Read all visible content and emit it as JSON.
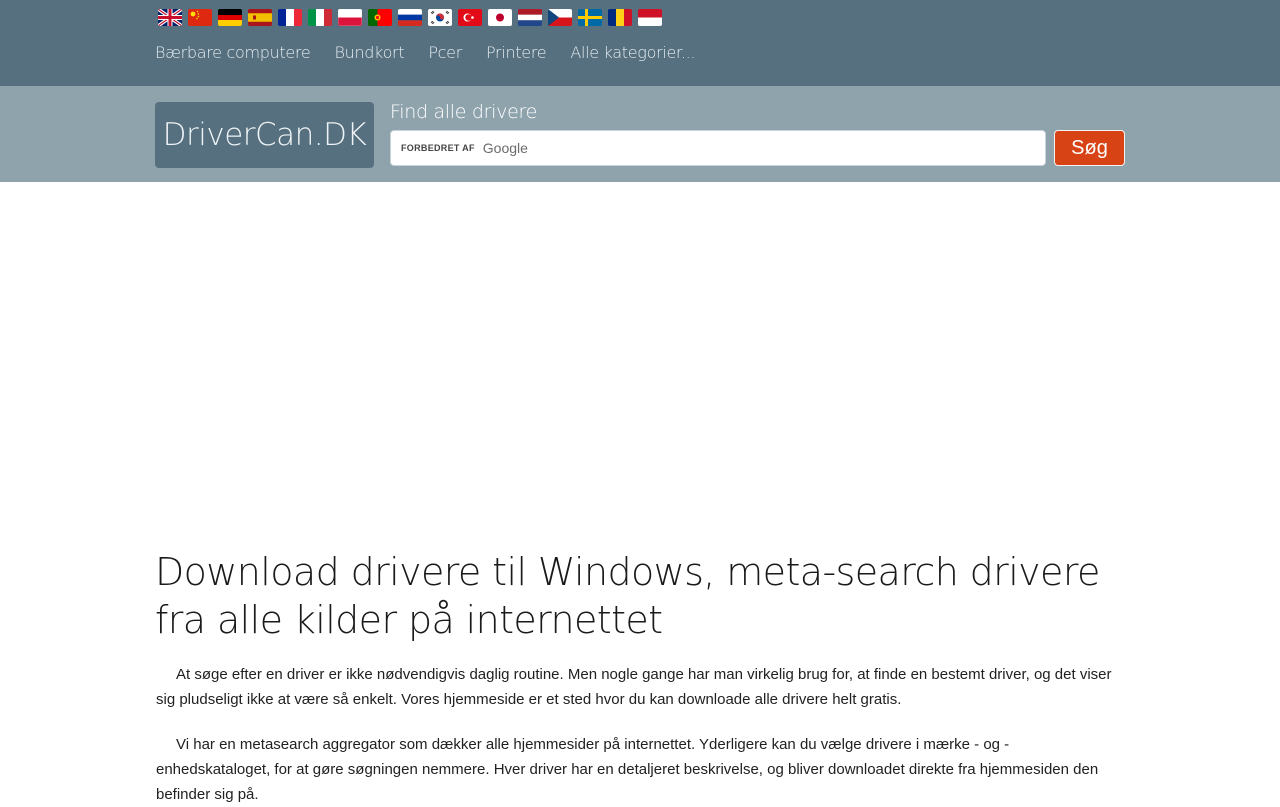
{
  "flags": [
    {
      "lang": "English",
      "icon": "flag-uk-icon"
    },
    {
      "lang": "Chinese",
      "icon": "flag-cn-icon"
    },
    {
      "lang": "German",
      "icon": "flag-de-icon"
    },
    {
      "lang": "Spanish",
      "icon": "flag-es-icon"
    },
    {
      "lang": "French",
      "icon": "flag-fr-icon"
    },
    {
      "lang": "Italian",
      "icon": "flag-it-icon"
    },
    {
      "lang": "Polish",
      "icon": "flag-pl-icon"
    },
    {
      "lang": "Portuguese",
      "icon": "flag-pt-icon"
    },
    {
      "lang": "Russian",
      "icon": "flag-ru-icon"
    },
    {
      "lang": "Korean",
      "icon": "flag-kr-icon"
    },
    {
      "lang": "Turkish",
      "icon": "flag-tr-icon"
    },
    {
      "lang": "Japanese",
      "icon": "flag-jp-icon"
    },
    {
      "lang": "Dutch",
      "icon": "flag-nl-icon"
    },
    {
      "lang": "Czech",
      "icon": "flag-cz-icon"
    },
    {
      "lang": "Swedish",
      "icon": "flag-se-icon"
    },
    {
      "lang": "Romanian",
      "icon": "flag-ro-icon"
    },
    {
      "lang": "Indonesian",
      "icon": "flag-id-icon"
    }
  ],
  "nav": {
    "items": [
      {
        "label": "Bærbare computere"
      },
      {
        "label": "Bundkort"
      },
      {
        "label": "Pcer"
      },
      {
        "label": "Printere"
      },
      {
        "label": "Alle kategorier..."
      }
    ]
  },
  "header": {
    "logo": "DriverCan.DK",
    "find_label": "Find alle drivere",
    "search_enhanced": "FORBEDRET AF",
    "search_brand": "Google",
    "search_button": "Søg"
  },
  "main": {
    "headline": "Download drivere til Windows, meta-search drivere fra alle kilder på internettet",
    "paragraphs": [
      "At søge efter en driver er ikke nødvendigvis daglig routine. Men nogle gange har man virkelig brug for, at finde en bestemt driver, og det viser sig pludseligt ikke at være så enkelt. Vores hjemmeside er et sted hvor du kan downloade alle drivere helt gratis.",
      "Vi har en metasearch aggregator som dækker alle hjemmesider på internettet. Yderligere kan du vælge drivere i mærke - og - enhedskataloget, for at gøre søgningen nemmere. Hver driver har en detaljeret beskrivelse, og bliver downloadet direkte fra hjemmesiden den befinder sig på."
    ]
  },
  "colors": {
    "topbar": "#56707f",
    "searchbar": "#8fa3ad",
    "button": "#d84315"
  }
}
